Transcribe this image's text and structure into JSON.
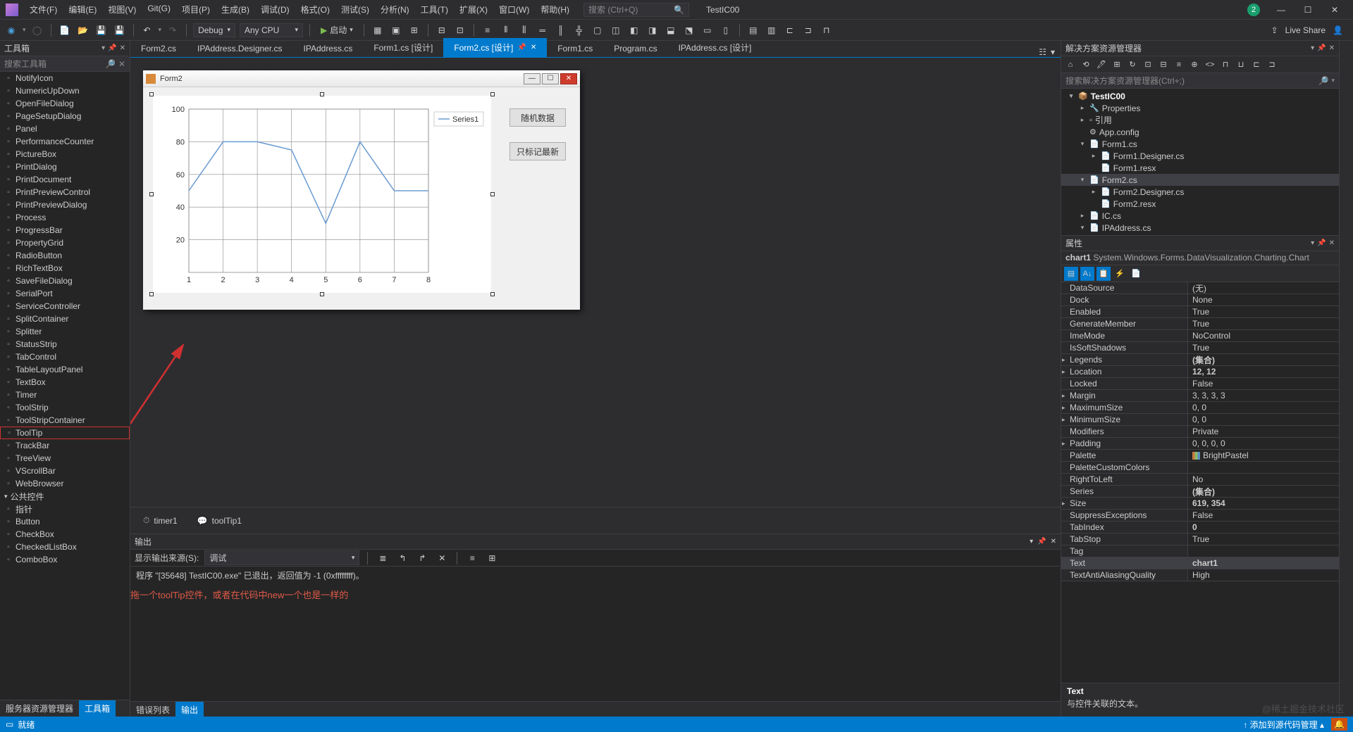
{
  "menu": [
    "文件(F)",
    "编辑(E)",
    "视图(V)",
    "Git(G)",
    "项目(P)",
    "生成(B)",
    "调试(D)",
    "格式(O)",
    "测试(S)",
    "分析(N)",
    "工具(T)",
    "扩展(X)",
    "窗口(W)",
    "帮助(H)"
  ],
  "titlebar": {
    "search_placeholder": "搜索 (Ctrl+Q)",
    "title": "TestIC00",
    "badge": "2"
  },
  "toolbar": {
    "config": "Debug",
    "platform": "Any CPU",
    "start": "启动",
    "liveshare": "Live Share"
  },
  "toolbox": {
    "title": "工具箱",
    "search_placeholder": "搜索工具箱",
    "items": [
      "NotifyIcon",
      "NumericUpDown",
      "OpenFileDialog",
      "PageSetupDialog",
      "Panel",
      "PerformanceCounter",
      "PictureBox",
      "PrintDialog",
      "PrintDocument",
      "PrintPreviewControl",
      "PrintPreviewDialog",
      "Process",
      "ProgressBar",
      "PropertyGrid",
      "RadioButton",
      "RichTextBox",
      "SaveFileDialog",
      "SerialPort",
      "ServiceController",
      "SplitContainer",
      "Splitter",
      "StatusStrip",
      "TabControl",
      "TableLayoutPanel",
      "TextBox",
      "Timer",
      "ToolStrip",
      "ToolStripContainer",
      "ToolTip",
      "TrackBar",
      "TreeView",
      "VScrollBar",
      "WebBrowser"
    ],
    "highlighted": "ToolTip",
    "group": "公共控件",
    "group_items": [
      "指针",
      "Button",
      "CheckBox",
      "CheckedListBox",
      "ComboBox"
    ],
    "bottom_tabs": [
      "服务器资源管理器",
      "工具箱"
    ]
  },
  "tabs": [
    "Form2.cs",
    "IPAddress.Designer.cs",
    "IPAddress.cs",
    "Form1.cs [设计]",
    "Form2.cs [设计]",
    "Form1.cs",
    "Program.cs",
    "IPAddress.cs [设计]"
  ],
  "active_tab": "Form2.cs [设计]",
  "form": {
    "title": "Form2",
    "button1": "随机数据",
    "button2": "只标记最新"
  },
  "chart_data": {
    "type": "line",
    "series_name": "Series1",
    "x": [
      1,
      2,
      3,
      4,
      5,
      6,
      7,
      8
    ],
    "y": [
      50,
      80,
      80,
      75,
      30,
      80,
      50,
      50
    ],
    "xticks": [
      1,
      2,
      3,
      4,
      5,
      6,
      7,
      8
    ],
    "yticks": [
      20,
      40,
      60,
      80,
      100
    ],
    "ylim": [
      0,
      100
    ]
  },
  "tray": [
    "timer1",
    "toolTip1"
  ],
  "output": {
    "title": "输出",
    "source_label": "显示输出来源(S):",
    "source": "调试",
    "text": "程序 \"[35648] TestIC00.exe\" 已退出，返回值为 -1 (0xffffffff)。",
    "annotation": "拖一个toolTip控件，或者在代码中new一个也是一样的",
    "bottom_tabs": [
      "错误列表",
      "输出"
    ]
  },
  "solution": {
    "title": "解决方案资源管理器",
    "search_placeholder": "搜索解决方案资源管理器(Ctrl+;)",
    "tree": [
      {
        "indent": 0,
        "exp": "▾",
        "icon": "📦",
        "label": "TestIC00",
        "bold": true
      },
      {
        "indent": 1,
        "exp": "▸",
        "icon": "🔧",
        "label": "Properties"
      },
      {
        "indent": 1,
        "exp": "▸",
        "icon": "▫",
        "label": "引用"
      },
      {
        "indent": 1,
        "exp": "",
        "icon": "⚙",
        "label": "App.config"
      },
      {
        "indent": 1,
        "exp": "▾",
        "icon": "📄",
        "label": "Form1.cs"
      },
      {
        "indent": 2,
        "exp": "▸",
        "icon": "📄",
        "label": "Form1.Designer.cs"
      },
      {
        "indent": 2,
        "exp": "",
        "icon": "📄",
        "label": "Form1.resx"
      },
      {
        "indent": 1,
        "exp": "▾",
        "icon": "📄",
        "label": "Form2.cs",
        "selected": true
      },
      {
        "indent": 2,
        "exp": "▸",
        "icon": "📄",
        "label": "Form2.Designer.cs"
      },
      {
        "indent": 2,
        "exp": "",
        "icon": "📄",
        "label": "Form2.resx"
      },
      {
        "indent": 1,
        "exp": "▸",
        "icon": "📄",
        "label": "IC.cs"
      },
      {
        "indent": 1,
        "exp": "▾",
        "icon": "📄",
        "label": "IPAddress.cs"
      }
    ]
  },
  "properties": {
    "title": "属性",
    "object_name": "chart1",
    "object_type": "System.Windows.Forms.DataVisualization.Charting.Chart",
    "rows": [
      {
        "name": "DataSource",
        "val": "(无)"
      },
      {
        "name": "Dock",
        "val": "None"
      },
      {
        "name": "Enabled",
        "val": "True"
      },
      {
        "name": "GenerateMember",
        "val": "True"
      },
      {
        "name": "ImeMode",
        "val": "NoControl"
      },
      {
        "name": "IsSoftShadows",
        "val": "True"
      },
      {
        "name": "Legends",
        "val": "(集合)",
        "exp": "▸",
        "bold": true
      },
      {
        "name": "Location",
        "val": "12, 12",
        "exp": "▸",
        "bold": true
      },
      {
        "name": "Locked",
        "val": "False"
      },
      {
        "name": "Margin",
        "val": "3, 3, 3, 3",
        "exp": "▸"
      },
      {
        "name": "MaximumSize",
        "val": "0, 0",
        "exp": "▸"
      },
      {
        "name": "MinimumSize",
        "val": "0, 0",
        "exp": "▸"
      },
      {
        "name": "Modifiers",
        "val": "Private"
      },
      {
        "name": "Padding",
        "val": "0, 0, 0, 0",
        "exp": "▸"
      },
      {
        "name": "Palette",
        "val": "BrightPastel",
        "swatch": true
      },
      {
        "name": "PaletteCustomColors",
        "val": ""
      },
      {
        "name": "RightToLeft",
        "val": "No"
      },
      {
        "name": "Series",
        "val": "(集合)",
        "bold": true
      },
      {
        "name": "Size",
        "val": "619, 354",
        "exp": "▸",
        "bold": true
      },
      {
        "name": "SuppressExceptions",
        "val": "False"
      },
      {
        "name": "TabIndex",
        "val": "0",
        "bold": true
      },
      {
        "name": "TabStop",
        "val": "True"
      },
      {
        "name": "Tag",
        "val": ""
      },
      {
        "name": "Text",
        "val": "chart1",
        "bold": true,
        "selected": true
      },
      {
        "name": "TextAntiAliasingQuality",
        "val": "High"
      }
    ],
    "desc_name": "Text",
    "desc_text": "与控件关联的文本。"
  },
  "statusbar": {
    "ready": "就绪",
    "add_src": "添加到源代码管理"
  },
  "watermark": "@稀土掘金技术社区"
}
